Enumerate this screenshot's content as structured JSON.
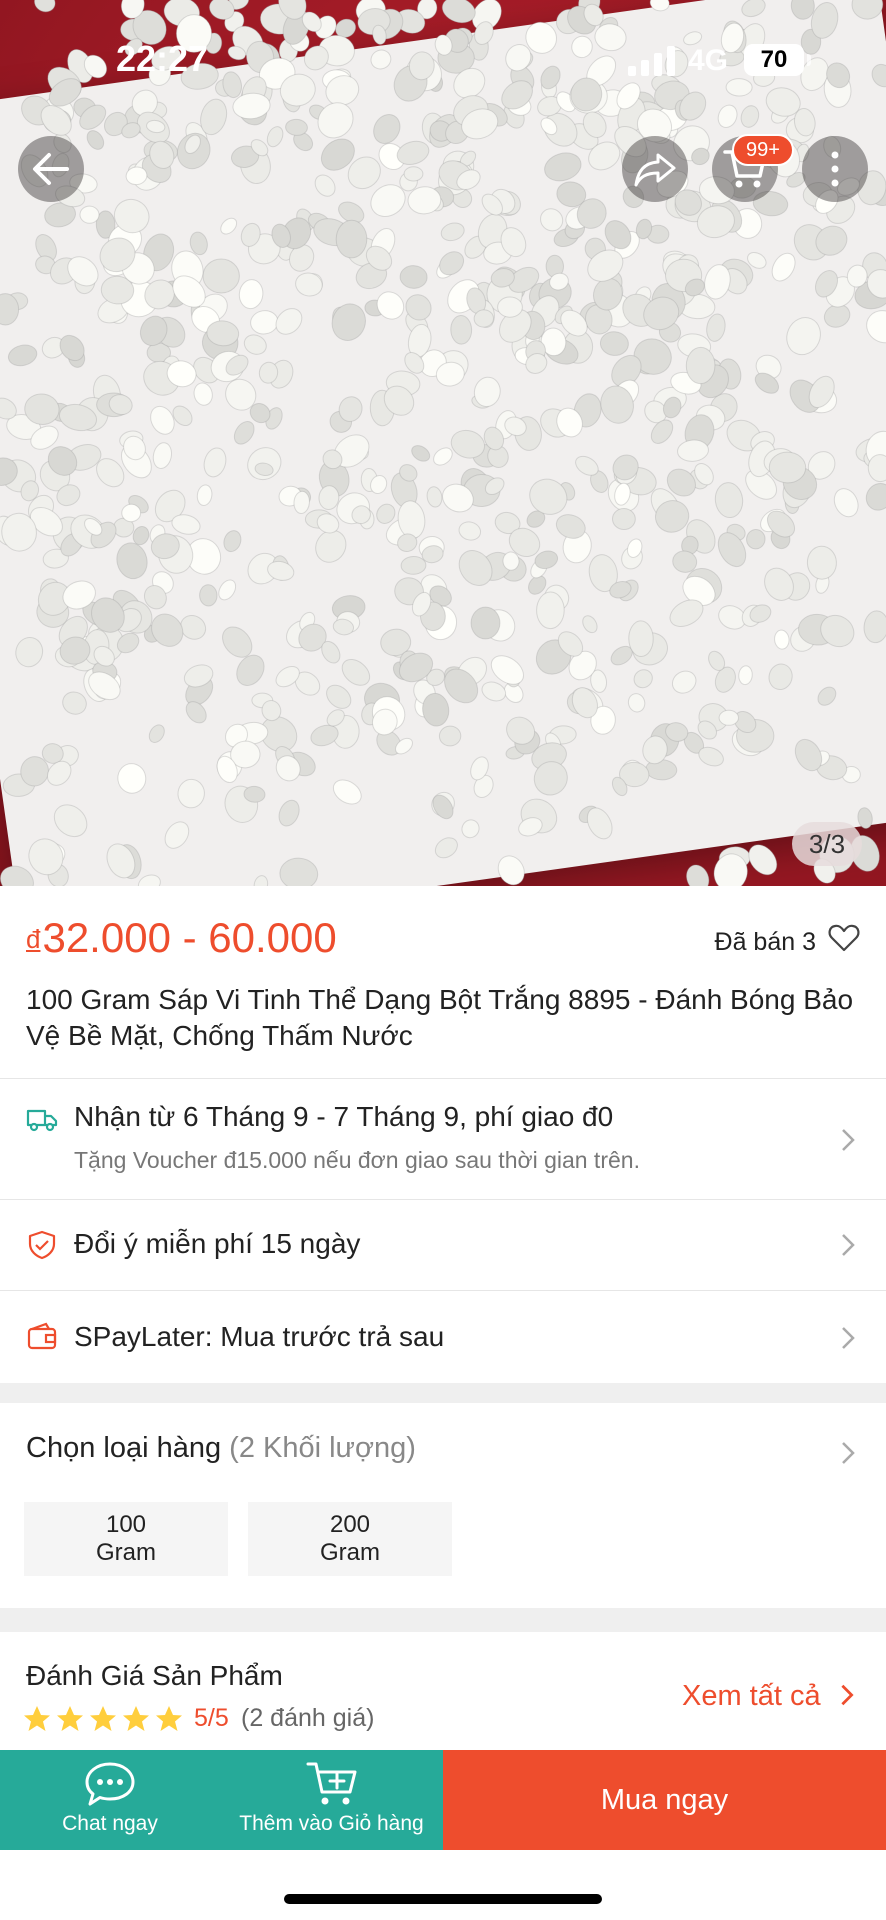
{
  "status_bar": {
    "time": "22:27",
    "network": "4G",
    "battery": "70"
  },
  "header": {
    "cart_badge": "99+"
  },
  "gallery": {
    "pager": "3/3"
  },
  "product": {
    "currency": "đ",
    "price_range": "32.000 - 60.000",
    "sold": "Đã bán 3",
    "title": "100 Gram Sáp Vi Tinh Thể Dạng Bột Trắng 8895 - Đánh Bóng Bảo Vệ Bề Mặt, Chống Thấm Nước"
  },
  "shipping": {
    "main": "Nhận từ 6 Tháng 9 - 7 Tháng 9, phí giao đ0",
    "sub": "Tặng Voucher đ15.000 nếu đơn giao sau thời gian trên."
  },
  "returns": {
    "label": "Đổi ý miễn phí 15 ngày"
  },
  "paylater": {
    "label": "SPayLater: Mua trước trả sau"
  },
  "variants": {
    "heading": "Chọn loại hàng",
    "count": "(2 Khối lượng)",
    "options": [
      {
        "line1": "100",
        "line2": "Gram"
      },
      {
        "line1": "200",
        "line2": "Gram"
      }
    ]
  },
  "reviews": {
    "heading": "Đánh Giá Sản Phẩm",
    "score": "5/5",
    "count": "(2 đánh giá)",
    "see_all": "Xem tất cả"
  },
  "bottom_bar": {
    "chat": "Chat ngay",
    "add_to_cart": "Thêm vào Giỏ hàng",
    "buy_now": "Mua ngay"
  },
  "colors": {
    "accent": "#ee4d2d",
    "teal": "#26aa99",
    "star": "#ffce3d"
  },
  "icons": [
    "arrow-left-icon",
    "share-icon",
    "cart-icon",
    "more-vertical-icon",
    "heart-icon",
    "truck-icon",
    "shield-check-icon",
    "wallet-icon",
    "chevron-right-icon",
    "star-icon",
    "chat-bubble-icon",
    "cart-plus-icon"
  ]
}
